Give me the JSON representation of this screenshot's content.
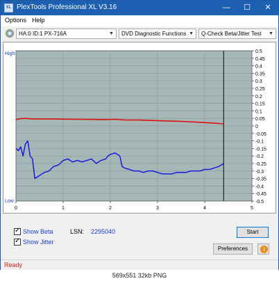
{
  "window": {
    "title": "PlexTools Professional XL V3.16",
    "app_icon_text": "XL",
    "minimize_glyph": "—",
    "maximize_glyph": "☐",
    "close_glyph": "✕"
  },
  "menu": {
    "items": [
      "Options",
      "Help"
    ]
  },
  "toolbar": {
    "drive": "HA:0 ID:1  PX-716A",
    "function": "DVD Diagnostic Functions",
    "test": "Q-Check Beta/Jitter Test",
    "arrow_glyph": "▼"
  },
  "chart_data": {
    "type": "line",
    "title": "",
    "x_ticks": [
      "0",
      "1",
      "2",
      "3",
      "4",
      "5"
    ],
    "xlim": [
      0,
      5
    ],
    "y_left_labels": {
      "top": "High",
      "bottom": "Low"
    },
    "y_right_ticks": [
      "0.5",
      "0.45",
      "0.4",
      "0.35",
      "0.3",
      "0.25",
      "0.2",
      "0.15",
      "0.1",
      "0.05",
      "0",
      "-0.05",
      "-0.1",
      "-0.15",
      "-0.2",
      "-0.25",
      "-0.3",
      "-0.35",
      "-0.4",
      "-0.45",
      "-0.5"
    ],
    "y_right_lim": [
      -0.5,
      0.5
    ],
    "end_marker_x": 4.4,
    "grid": true,
    "series": [
      {
        "color": "#e01010",
        "points": [
          [
            0.0,
            0.042
          ],
          [
            0.1,
            0.048
          ],
          [
            0.2,
            0.05
          ],
          [
            0.3,
            0.047
          ],
          [
            0.5,
            0.046
          ],
          [
            0.8,
            0.046
          ],
          [
            1.0,
            0.045
          ],
          [
            1.3,
            0.044
          ],
          [
            1.6,
            0.043
          ],
          [
            1.9,
            0.042
          ],
          [
            2.1,
            0.044
          ],
          [
            2.3,
            0.04
          ],
          [
            2.6,
            0.039
          ],
          [
            2.9,
            0.036
          ],
          [
            3.2,
            0.033
          ],
          [
            3.5,
            0.03
          ],
          [
            3.8,
            0.026
          ],
          [
            4.0,
            0.022
          ],
          [
            4.2,
            0.018
          ],
          [
            4.4,
            0.014
          ]
        ]
      },
      {
        "color": "#1010e0",
        "points": [
          [
            0.0,
            -0.15
          ],
          [
            0.05,
            -0.165
          ],
          [
            0.1,
            -0.14
          ],
          [
            0.15,
            -0.2
          ],
          [
            0.2,
            -0.12
          ],
          [
            0.25,
            -0.1
          ],
          [
            0.3,
            -0.2
          ],
          [
            0.35,
            -0.22
          ],
          [
            0.4,
            -0.35
          ],
          [
            0.5,
            -0.33
          ],
          [
            0.6,
            -0.31
          ],
          [
            0.7,
            -0.3
          ],
          [
            0.8,
            -0.27
          ],
          [
            0.9,
            -0.26
          ],
          [
            1.0,
            -0.23
          ],
          [
            1.1,
            -0.22
          ],
          [
            1.2,
            -0.24
          ],
          [
            1.3,
            -0.23
          ],
          [
            1.4,
            -0.24
          ],
          [
            1.5,
            -0.23
          ],
          [
            1.6,
            -0.22
          ],
          [
            1.7,
            -0.25
          ],
          [
            1.8,
            -0.23
          ],
          [
            1.9,
            -0.22
          ],
          [
            1.95,
            -0.2
          ],
          [
            2.0,
            -0.19
          ],
          [
            2.1,
            -0.18
          ],
          [
            2.2,
            -0.2
          ],
          [
            2.25,
            -0.27
          ],
          [
            2.3,
            -0.28
          ],
          [
            2.4,
            -0.29
          ],
          [
            2.5,
            -0.3
          ],
          [
            2.6,
            -0.3
          ],
          [
            2.7,
            -0.31
          ],
          [
            2.8,
            -0.3
          ],
          [
            2.9,
            -0.3
          ],
          [
            3.0,
            -0.31
          ],
          [
            3.1,
            -0.32
          ],
          [
            3.2,
            -0.32
          ],
          [
            3.3,
            -0.32
          ],
          [
            3.4,
            -0.31
          ],
          [
            3.5,
            -0.31
          ],
          [
            3.6,
            -0.31
          ],
          [
            3.7,
            -0.3
          ],
          [
            3.8,
            -0.3
          ],
          [
            3.9,
            -0.3
          ],
          [
            4.0,
            -0.29
          ],
          [
            4.1,
            -0.29
          ],
          [
            4.2,
            -0.28
          ],
          [
            4.3,
            -0.27
          ],
          [
            4.35,
            -0.26
          ],
          [
            4.4,
            -0.25
          ]
        ]
      }
    ]
  },
  "options": {
    "show_beta": {
      "label": "Show Beta",
      "checked": true
    },
    "show_jitter": {
      "label": "Show Jitter",
      "checked": true
    },
    "check_glyph": "✓"
  },
  "lsn": {
    "label": "LSN:",
    "value": "2295040"
  },
  "buttons": {
    "start": "Start",
    "preferences": "Preferences",
    "info_glyph": "i"
  },
  "status": {
    "text": "Ready"
  },
  "caption": "569x551  32kb  PNG",
  "colors": {
    "titlebar": "#1d5fb0",
    "plot_bg": "#a6b7b7",
    "beta_line": "#e01010",
    "jitter_line": "#1010e0"
  }
}
